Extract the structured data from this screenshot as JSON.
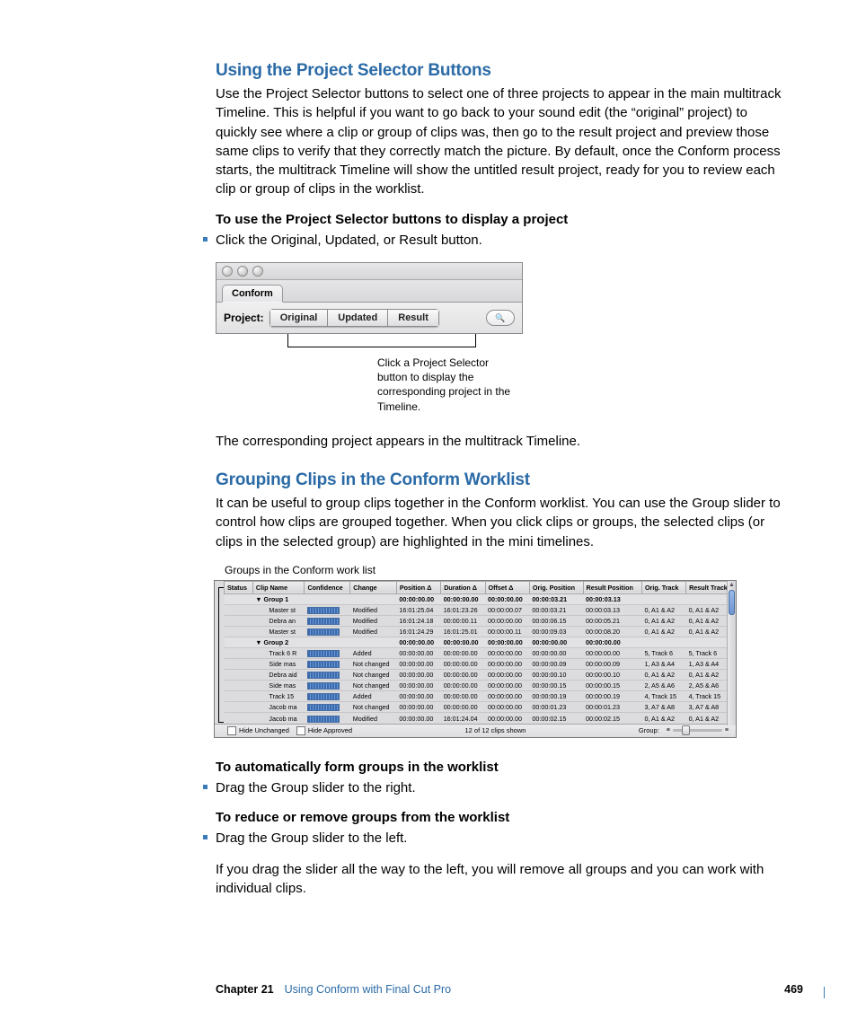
{
  "section1": {
    "heading": "Using the Project Selector Buttons",
    "para1": "Use the Project Selector buttons to select one of three projects to appear in the main multitrack Timeline. This is helpful if you want to go back to your sound edit (the “original” project) to quickly see where a clip or group of clips was, then go to the result project and preview those same clips to verify that they correctly match the picture. By default, once the Conform process starts, the multitrack Timeline will show the untitled result project, ready for you to review each clip or group of clips in the worklist.",
    "sub1": "To use the Project Selector buttons to display a project",
    "bullet1": "Click the Original, Updated, or Result button.",
    "caption": "Click a Project Selector button to display the corresponding project in the Timeline.",
    "para2": "The corresponding project appears in the multitrack Timeline."
  },
  "ps_ui": {
    "tab": "Conform",
    "label": "Project:",
    "buttons": [
      "Original",
      "Updated",
      "Result"
    ],
    "search_glyph": "🔍"
  },
  "section2": {
    "heading": "Grouping Clips in the Conform Worklist",
    "para1": "It can be useful to group clips together in the Conform worklist. You can use the Group slider to control how clips are grouped together. When you click clips or groups, the selected clips (or clips in the selected group) are highlighted in the mini timelines.",
    "callout": "Groups in the Conform work list",
    "sub1": "To automatically form groups in the worklist",
    "bullet1": "Drag the Group slider to the right.",
    "sub2": "To reduce or remove groups from the worklist",
    "bullet2": "Drag the Group slider to the left.",
    "para2": "If you drag the slider all the way to the left, you will remove all groups and you can work with individual clips."
  },
  "worklist": {
    "headers": [
      "Status",
      "Clip Name",
      "Confidence",
      "Change",
      "Position Δ",
      "Duration Δ",
      "Offset Δ",
      "Orig. Position",
      "Result Position",
      "Orig. Track",
      "Result Track"
    ],
    "rows": [
      {
        "group": true,
        "name": "▼ Group 1",
        "pos": "00:00:00.00",
        "dur": "00:00:00.00",
        "off": "00:00:00.00",
        "opos": "00:00:03.21",
        "rpos": "00:00:03.13"
      },
      {
        "name": "Master st",
        "conf": 34,
        "change": "Modified",
        "pos": "16:01:25.04",
        "dur": "16:01:23.26",
        "off": "00:00:00.07",
        "opos": "00:00:03.21",
        "rpos": "00:00:03.13",
        "otrk": "0, A1 & A2",
        "rtrk": "0, A1 & A2"
      },
      {
        "name": "Debra an",
        "conf": 34,
        "change": "Modified",
        "pos": "16:01:24.18",
        "dur": "00:00:00.11",
        "off": "00:00:00.00",
        "opos": "00:00:06.15",
        "rpos": "00:00:05.21",
        "otrk": "0, A1 & A2",
        "rtrk": "0, A1 & A2"
      },
      {
        "name": "Master st",
        "conf": 34,
        "change": "Modified",
        "pos": "16:01:24.29",
        "dur": "16:01:25.01",
        "off": "00:00:00.11",
        "opos": "00:00:09.03",
        "rpos": "00:00:08.20",
        "otrk": "0, A1 & A2",
        "rtrk": "0, A1 & A2"
      },
      {
        "group": true,
        "name": "▼ Group 2",
        "pos": "00:00:00.00",
        "dur": "00:00:00.00",
        "off": "00:00:00.00",
        "opos": "00:00:00.00",
        "rpos": "00:00:00.00"
      },
      {
        "name": "Track 6 R",
        "conf": 34,
        "change": "Added",
        "pos": "00:00:00.00",
        "dur": "00:00:00.00",
        "off": "00:00:00.00",
        "opos": "00:00:00.00",
        "rpos": "00:00:00.00",
        "otrk": "5, Track 6",
        "rtrk": "5, Track 6"
      },
      {
        "name": "Side mas",
        "conf": 34,
        "change": "Not changed",
        "pos": "00:00:00.00",
        "dur": "00:00:00.00",
        "off": "00:00:00.00",
        "opos": "00:00:00.09",
        "rpos": "00:00:00.09",
        "otrk": "1, A3 & A4",
        "rtrk": "1, A3 & A4"
      },
      {
        "name": "Debra aid",
        "conf": 34,
        "change": "Not changed",
        "pos": "00:00:00.00",
        "dur": "00:00:00.00",
        "off": "00:00:00.00",
        "opos": "00:00:00.10",
        "rpos": "00:00:00.10",
        "otrk": "0, A1 & A2",
        "rtrk": "0, A1 & A2"
      },
      {
        "name": "Side mas",
        "conf": 34,
        "change": "Not changed",
        "pos": "00:00:00.00",
        "dur": "00:00:00.00",
        "off": "00:00:00.00",
        "opos": "00:00:00.15",
        "rpos": "00:00:00.15",
        "otrk": "2, A5 & A6",
        "rtrk": "2, A5 & A6"
      },
      {
        "name": "Track 15",
        "conf": 34,
        "change": "Added",
        "pos": "00:00:00.00",
        "dur": "00:00:00.00",
        "off": "00:00:00.00",
        "opos": "00:00:00.19",
        "rpos": "00:00:00.19",
        "otrk": "4, Track 15",
        "rtrk": "4, Track 15"
      },
      {
        "name": "Jacob ma",
        "conf": 34,
        "change": "Not changed",
        "pos": "00:00:00.00",
        "dur": "00:00:00.00",
        "off": "00:00:00.00",
        "opos": "00:00:01.23",
        "rpos": "00:00:01.23",
        "otrk": "3, A7 & A8",
        "rtrk": "3, A7 & A8"
      },
      {
        "name": "Jacob ma",
        "conf": 34,
        "change": "Modified",
        "pos": "00:00:00.00",
        "dur": "16:01:24.04",
        "off": "00:00:00.00",
        "opos": "00:00:02.15",
        "rpos": "00:00:02.15",
        "otrk": "0, A1 & A2",
        "rtrk": "0, A1 & A2"
      }
    ],
    "footer": {
      "hide_unchanged": "Hide Unchanged",
      "hide_approved": "Hide Approved",
      "count": "12 of 12 clips shown",
      "group_label": "Group:"
    }
  },
  "footer": {
    "chapter_label": "Chapter 21",
    "chapter_title": "Using Conform with Final Cut Pro",
    "page": "469"
  }
}
